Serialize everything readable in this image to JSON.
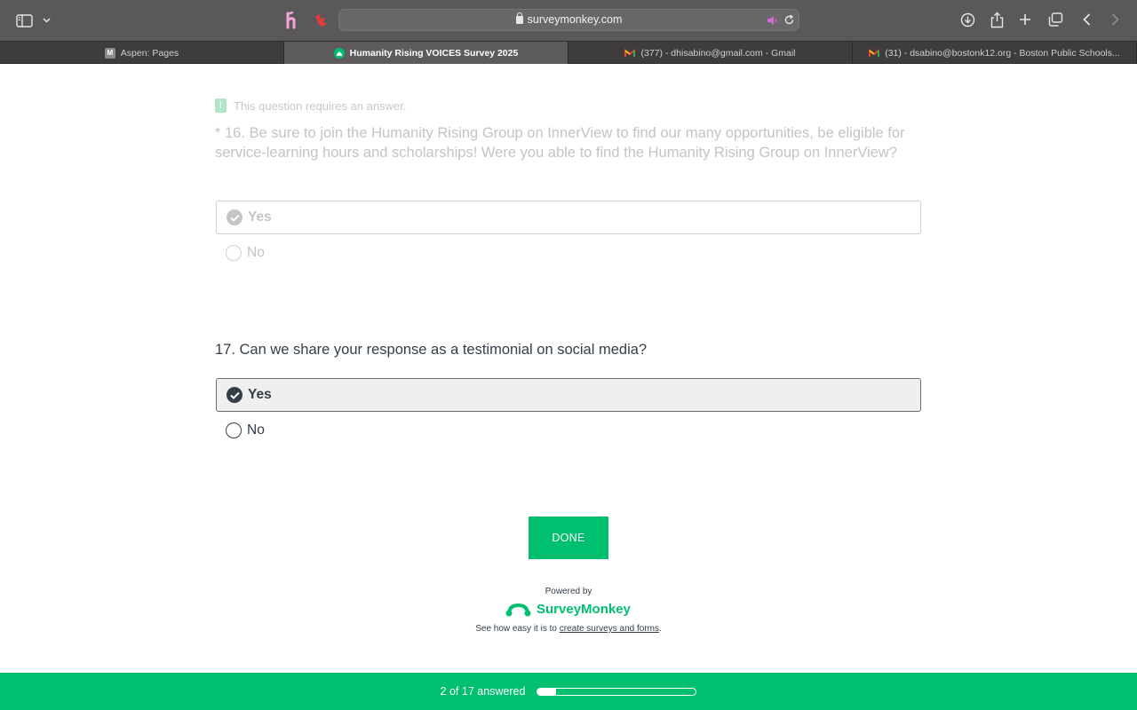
{
  "browser": {
    "url": "surveymonkey.com",
    "tabs": [
      {
        "label": "Aspen: Pages",
        "favicon_letter": "M",
        "favicon_color": "#8a8a8a",
        "active": false
      },
      {
        "label": "Humanity Rising VOICES Survey 2025",
        "favicon_color": "#00bf6f",
        "active": true
      },
      {
        "label": "(377) - dhisabino@gmail.com - Gmail",
        "favicon": "gmail-icon",
        "active": false
      },
      {
        "label": "(31) - dsabino@bostonk12.org - Boston Public Schools...",
        "favicon": "gmail-icon",
        "active": false
      }
    ],
    "extension_icons": [
      "honey-extension-icon",
      "red-extension-icon"
    ]
  },
  "survey": {
    "warning": "This question requires an answer.",
    "question16": {
      "text": "* 16. Be sure to join the Humanity Rising Group on InnerView to find our many opportunities, be eligible for service-learning hours and scholarships! Were you able to find the Humanity Rising Group on InnerView?",
      "options": [
        "Yes",
        "No"
      ],
      "selected": "Yes"
    },
    "question17": {
      "text": "17. Can we share your response as a testimonial on social media?",
      "options": [
        "Yes",
        "No"
      ],
      "selected": "Yes"
    },
    "done_label": "DONE",
    "powered_by": "Powered by",
    "brand": "SurveyMonkey",
    "see_how_prefix": "See how easy it is to ",
    "see_how_link": "create surveys and forms",
    "see_how_suffix": "."
  },
  "progress": {
    "text": "2 of 17 answered",
    "answered": 2,
    "total": 17
  },
  "colors": {
    "accent": "#00bf6f",
    "text_dark": "#333e48",
    "text_faded": "#c4c4c4"
  }
}
